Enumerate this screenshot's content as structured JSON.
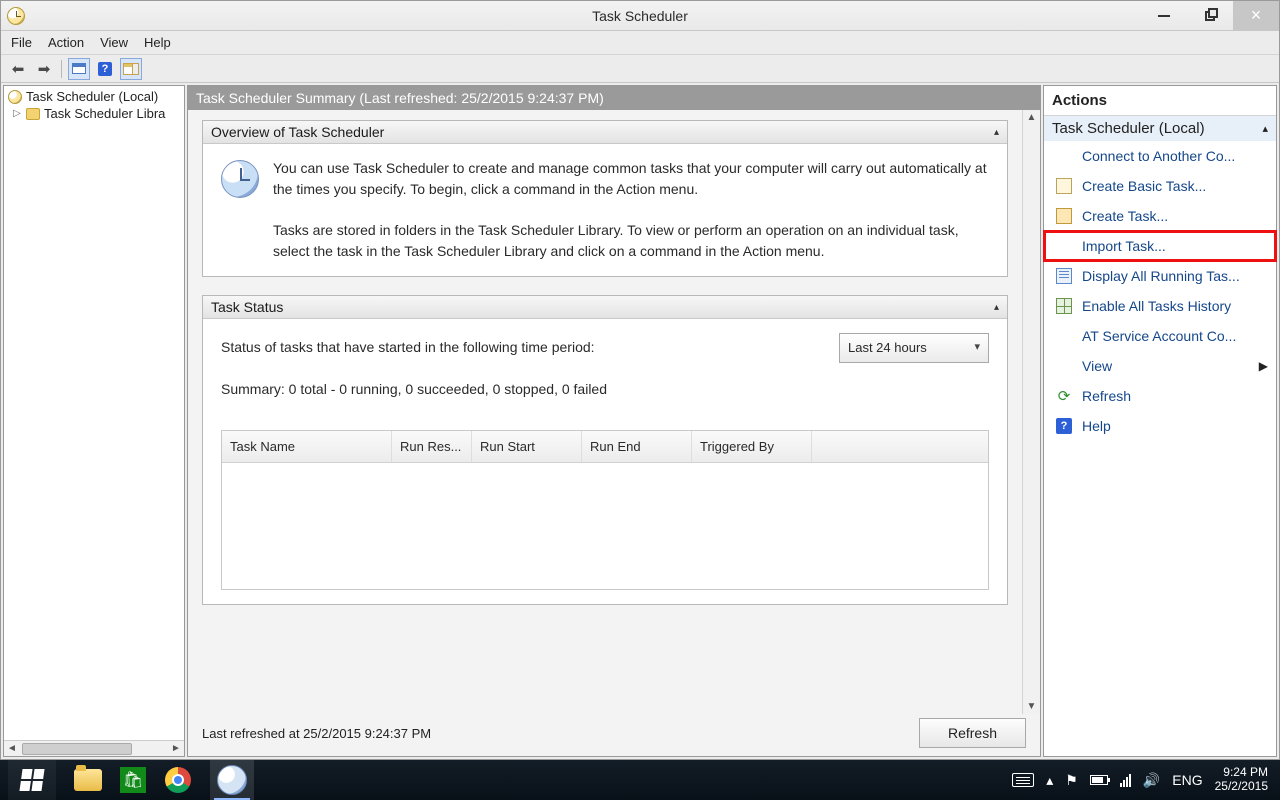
{
  "window": {
    "title": "Task Scheduler",
    "menus": {
      "file": "File",
      "action": "Action",
      "view": "View",
      "help": "Help"
    }
  },
  "tree": {
    "root": "Task Scheduler (Local)",
    "library": "Task Scheduler Libra"
  },
  "summary": {
    "header": "Task Scheduler Summary (Last refreshed: 25/2/2015 9:24:37 PM)",
    "overview_title": "Overview of Task Scheduler",
    "overview_p1": "You can use Task Scheduler to create and manage common tasks that your computer will carry out automatically at the times you specify. To begin, click a command in the Action menu.",
    "overview_p2": "Tasks are stored in folders in the Task Scheduler Library. To view or perform an operation on an individual task, select the task in the Task Scheduler Library and click on a command in the Action menu.",
    "status_title": "Task Status",
    "status_period_label": "Status of tasks that have started in the following time period:",
    "status_period_value": "Last 24 hours",
    "status_summary": "Summary: 0 total - 0 running, 0 succeeded, 0 stopped, 0 failed",
    "table": {
      "h_task": "Task Name",
      "h_runres": "Run Res...",
      "h_runstart": "Run Start",
      "h_runend": "Run End",
      "h_trigger": "Triggered By"
    },
    "footer_last": "Last refreshed at 25/2/2015 9:24:37 PM",
    "refresh_btn": "Refresh"
  },
  "actions": {
    "title": "Actions",
    "subtitle": "Task Scheduler (Local)",
    "items": {
      "connect": "Connect to Another Co...",
      "create_basic": "Create Basic Task...",
      "create_task": "Create Task...",
      "import_task": "Import Task...",
      "display_running": "Display All Running Tas...",
      "enable_history": "Enable All Tasks History",
      "at_service": "AT Service Account Co...",
      "view": "View",
      "refresh": "Refresh",
      "help": "Help"
    }
  },
  "taskbar": {
    "lang": "ENG",
    "time": "9:24 PM",
    "date": "25/2/2015"
  }
}
